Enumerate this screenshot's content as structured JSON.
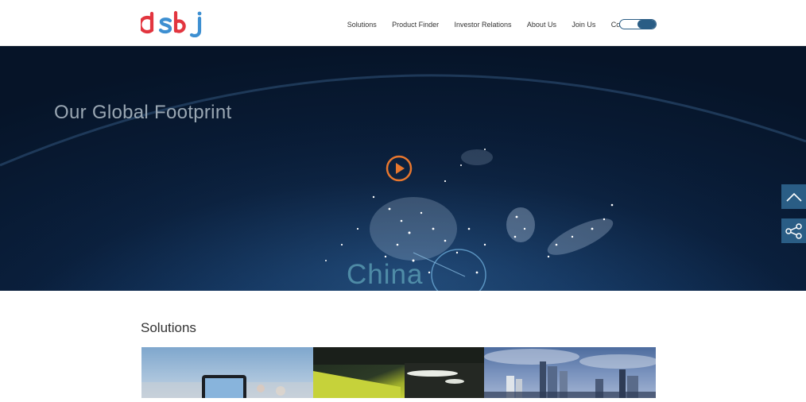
{
  "brand": {
    "logo_text": "dsbj"
  },
  "nav": {
    "items": [
      {
        "label": "Solutions"
      },
      {
        "label": "Product Finder"
      },
      {
        "label": "Investor Relations"
      },
      {
        "label": "About Us"
      },
      {
        "label": "Join Us"
      },
      {
        "label": "Contact Us"
      }
    ]
  },
  "hero": {
    "title": "Our Global Footprint",
    "region_label": "China"
  },
  "solutions": {
    "title": "Solutions"
  },
  "colors": {
    "accent": "#2a5d85",
    "play_orange": "#e8772e",
    "logo_red": "#e2353f",
    "logo_blue": "#3d8fd1"
  },
  "icons": {
    "play": "play-circle-icon",
    "back_to_top": "chevron-up-icon",
    "share": "share-icon"
  }
}
